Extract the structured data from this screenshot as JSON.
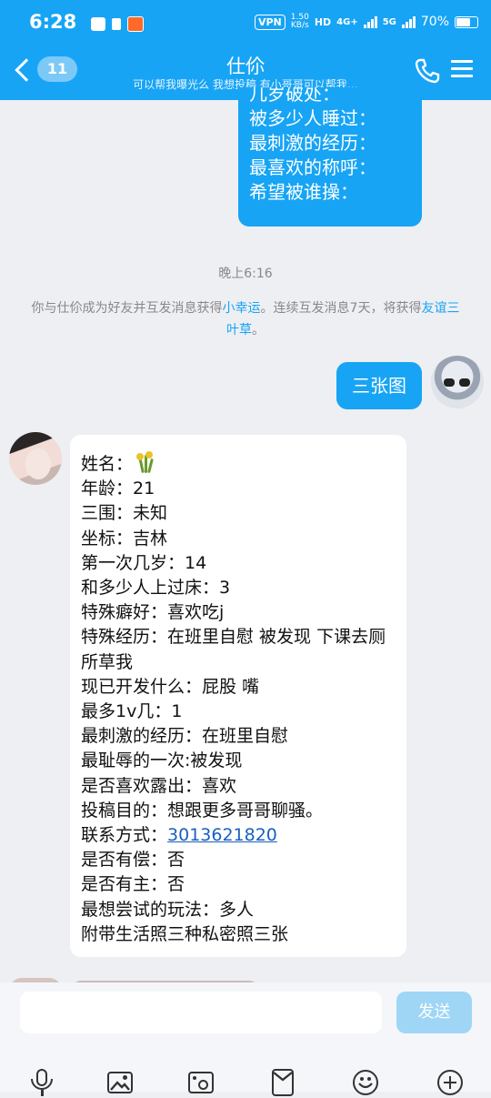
{
  "status_bar": {
    "time": "6:28",
    "vpn": "VPN",
    "speed_value": "1.50",
    "speed_unit": "KB/s",
    "hd": "HD",
    "net1": "4G+",
    "net2": "5G",
    "battery": "70%"
  },
  "header": {
    "unread_count": "11",
    "title": "仕伱",
    "subtitle": "可以帮我曝光么  我想投稿  有小哥哥可以帮我…"
  },
  "top_bubble_lines": [
    "几岁破处：",
    "被多少人睡过：",
    "最刺激的经历：",
    "最喜欢的称呼：",
    "希望被谁操："
  ],
  "timestamp": "晚上6:16",
  "notice": {
    "part1": "你与仕伱成为好友并互发消息获得",
    "link1": "小幸运",
    "part2": "。连续互发消息7天，将获得",
    "link2": "友谊三叶草",
    "part3": "。"
  },
  "my_message": "三张图",
  "their_message": {
    "name_label": "姓名：",
    "lines": [
      "年龄：21",
      "三围：未知",
      "坐标：吉林",
      "第一次几岁：14",
      "和多少人上过床：3",
      "特殊癖好：喜欢吃j",
      "特殊经历：在班里自慰  被发现  下课去厕所草我",
      "现已开发什么：屁股  嘴",
      "最多1v几：1",
      "最刺激的经历：在班里自慰",
      "最耻辱的一次:被发现",
      "是否喜欢露出：喜欢",
      "投稿目的：想跟更多哥哥聊骚。"
    ],
    "contact_label": "联系方式：",
    "contact_value": "3013621820",
    "lines_after": [
      "是否有偿：否",
      "是否有主：否",
      "最想尝试的玩法：多人",
      "附带生活照三种私密照三张"
    ]
  },
  "input": {
    "placeholder": "",
    "send_label": "发送"
  },
  "colors": {
    "accent": "#17a4f5",
    "background": "#eeeff3"
  }
}
